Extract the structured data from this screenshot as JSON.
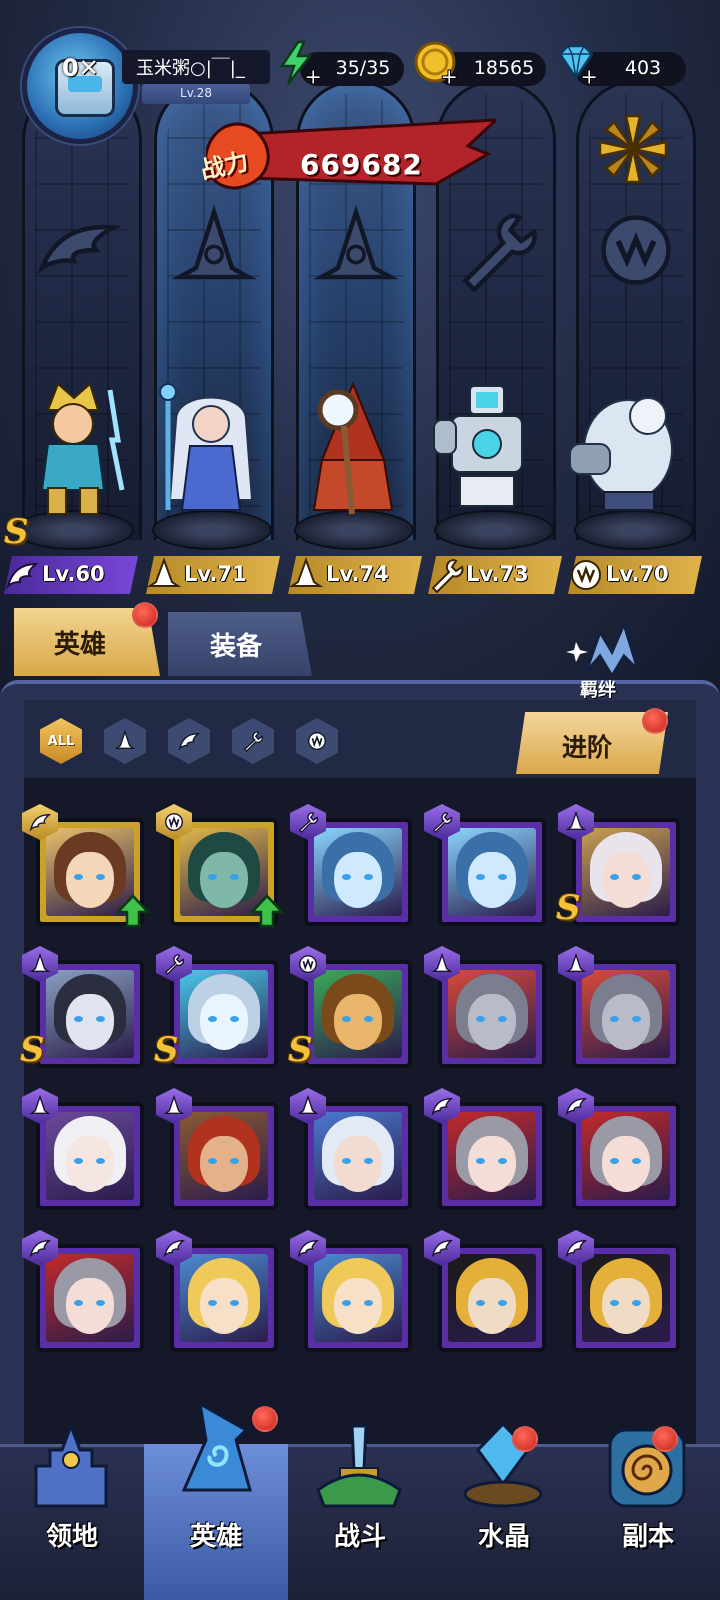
{
  "player": {
    "name": "玉米粥○|￣|_",
    "level": "Lv.28",
    "vip_badge": "0✕"
  },
  "resources": {
    "stamina": "35/35",
    "gold": "18565",
    "diamonds": "403"
  },
  "combat_power": {
    "label": "战力",
    "value": "669682"
  },
  "lineup": [
    {
      "level": "Lv.60",
      "class_icon": "wing-icon",
      "tag_color": "#6a3ec8",
      "s_rank": true
    },
    {
      "level": "Lv.71",
      "class_icon": "wizard-hat-icon",
      "tag_color": "#d4a23c",
      "s_rank": false
    },
    {
      "level": "Lv.74",
      "class_icon": "wizard-hat-icon",
      "tag_color": "#d4a23c",
      "s_rank": false
    },
    {
      "level": "Lv.73",
      "class_icon": "wrench-icon",
      "tag_color": "#d4a23c",
      "s_rank": false
    },
    {
      "level": "Lv.70",
      "class_icon": "beast-claw-icon",
      "tag_color": "#d4a23c",
      "s_rank": false
    }
  ],
  "tabs": {
    "heroes": "英雄",
    "equipment": "装备",
    "bond": "羁绊"
  },
  "filters": {
    "all": "ALL"
  },
  "advance_button": "进阶",
  "roster": [
    {
      "frame": "gold",
      "class_icon": "wing-icon",
      "can_upgrade": true,
      "s_rank": false
    },
    {
      "frame": "gold",
      "class_icon": "beast-claw-icon",
      "can_upgrade": true,
      "s_rank": false
    },
    {
      "frame": "purple",
      "class_icon": "wrench-icon",
      "can_upgrade": false,
      "s_rank": false
    },
    {
      "frame": "purple",
      "class_icon": "wrench-icon",
      "can_upgrade": false,
      "s_rank": false
    },
    {
      "frame": "purple",
      "class_icon": "wizard-hat-icon",
      "can_upgrade": false,
      "s_rank": true
    },
    {
      "frame": "purple",
      "class_icon": "wizard-hat-icon",
      "can_upgrade": false,
      "s_rank": true
    },
    {
      "frame": "purple",
      "class_icon": "wrench-icon",
      "can_upgrade": false,
      "s_rank": true
    },
    {
      "frame": "purple",
      "class_icon": "beast-claw-icon",
      "can_upgrade": false,
      "s_rank": true
    },
    {
      "frame": "purple",
      "class_icon": "wizard-hat-icon",
      "can_upgrade": false,
      "s_rank": false
    },
    {
      "frame": "purple",
      "class_icon": "wizard-hat-icon",
      "can_upgrade": false,
      "s_rank": false
    },
    {
      "frame": "purple",
      "class_icon": "wizard-hat-icon",
      "can_upgrade": false,
      "s_rank": false
    },
    {
      "frame": "purple",
      "class_icon": "wizard-hat-icon",
      "can_upgrade": false,
      "s_rank": false
    },
    {
      "frame": "purple",
      "class_icon": "wizard-hat-icon",
      "can_upgrade": false,
      "s_rank": false
    },
    {
      "frame": "purple",
      "class_icon": "wing-icon",
      "can_upgrade": false,
      "s_rank": false
    },
    {
      "frame": "purple",
      "class_icon": "wing-icon",
      "can_upgrade": false,
      "s_rank": false
    },
    {
      "frame": "purple",
      "class_icon": "wing-icon",
      "can_upgrade": false,
      "s_rank": false
    },
    {
      "frame": "purple",
      "class_icon": "wing-icon",
      "can_upgrade": false,
      "s_rank": false
    },
    {
      "frame": "purple",
      "class_icon": "wing-icon",
      "can_upgrade": false,
      "s_rank": false
    },
    {
      "frame": "purple",
      "class_icon": "wing-icon",
      "can_upgrade": false,
      "s_rank": false
    },
    {
      "frame": "purple",
      "class_icon": "wing-icon",
      "can_upgrade": false,
      "s_rank": false
    }
  ],
  "bottom_nav": {
    "territory": "领地",
    "heroes": "英雄",
    "battle": "战斗",
    "crystal": "水晶",
    "dungeon": "副本"
  },
  "colors": {
    "gold_accent": "#d9a84c",
    "purple_frame": "#5a2ea6",
    "notification_red": "#d62a1f",
    "panel_bg": "#2a3152"
  }
}
